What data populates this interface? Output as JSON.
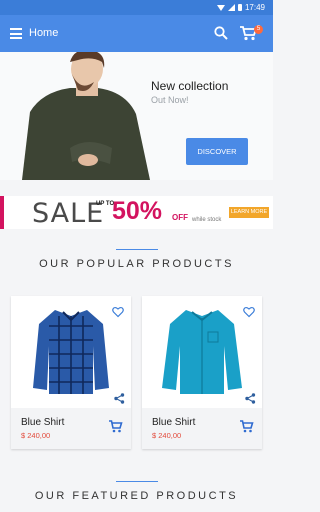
{
  "status": {
    "time": "17:49"
  },
  "appbar": {
    "title": "Home",
    "cart_count": "5"
  },
  "hero": {
    "title": "New collection",
    "subtitle": "Out Now!",
    "button": "DISCOVER"
  },
  "promo": {
    "sale": "SALE",
    "up_to": "UP TO",
    "percent": "50%",
    "off": "OFF",
    "stock": "while stock",
    "learn": "LEARN MORE"
  },
  "sections": {
    "popular": "OUR POPULAR PRODUCTS",
    "featured": "OUR FEATURED PRODUCTS"
  },
  "products": [
    {
      "name": "Blue Shirt",
      "price": "$ 240,00",
      "color": "#2a5aa8"
    },
    {
      "name": "Blue Shirt",
      "price": "$ 240,00",
      "color": "#1aa0c8"
    }
  ],
  "colors": {
    "primary": "#4a8ae6",
    "accent": "#d3135f",
    "price": "#e24a3b"
  }
}
